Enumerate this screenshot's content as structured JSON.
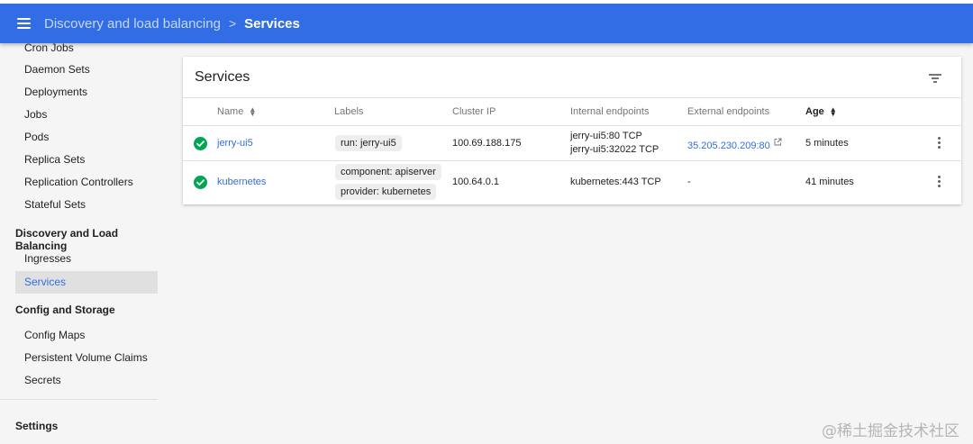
{
  "header": {
    "breadcrumb_parent": "Discovery and load balancing",
    "breadcrumb_separator": ">",
    "breadcrumb_current": "Services",
    "menu_icon": "hamburger-menu-icon",
    "bar_color": "#326de6"
  },
  "sidebar": {
    "workloads_items": [
      "Cron Jobs",
      "Daemon Sets",
      "Deployments",
      "Jobs",
      "Pods",
      "Replica Sets",
      "Replication Controllers",
      "Stateful Sets"
    ],
    "discovery_section": "Discovery and Load Balancing",
    "discovery_items": [
      "Ingresses",
      "Services"
    ],
    "active_item": "Services",
    "config_section": "Config and Storage",
    "config_items": [
      "Config Maps",
      "Persistent Volume Claims",
      "Secrets"
    ],
    "settings": "Settings"
  },
  "services_card": {
    "title": "Services",
    "filter_icon": "filter-list-icon",
    "columns": {
      "name": "Name",
      "labels": "Labels",
      "cluster_ip": "Cluster IP",
      "internal_endpoints": "Internal endpoints",
      "external_endpoints": "External endpoints",
      "age": "Age"
    },
    "rows": [
      {
        "status_icon": "check-circle-icon",
        "name": "jerry-ui5",
        "labels": [
          "run: jerry-ui5"
        ],
        "cluster_ip": "100.69.188.175",
        "internal_endpoints": [
          "jerry-ui5:80 TCP",
          "jerry-ui5:32022 TCP"
        ],
        "external_endpoint": "35.205.230.209:80",
        "external_icon": "open-in-new-icon",
        "age": "5 minutes"
      },
      {
        "status_icon": "check-circle-icon",
        "name": "kubernetes",
        "labels": [
          "component: apiserver",
          "provider: kubernetes"
        ],
        "cluster_ip": "100.64.0.1",
        "internal_endpoints": [
          "kubernetes:443 TCP"
        ],
        "external_endpoint": "-",
        "age": "41 minutes"
      }
    ]
  },
  "watermark": "@稀土掘金技术社区",
  "colors": {
    "accent": "#326de6",
    "success": "#00a651",
    "active_bg": "#e0e0e0"
  }
}
